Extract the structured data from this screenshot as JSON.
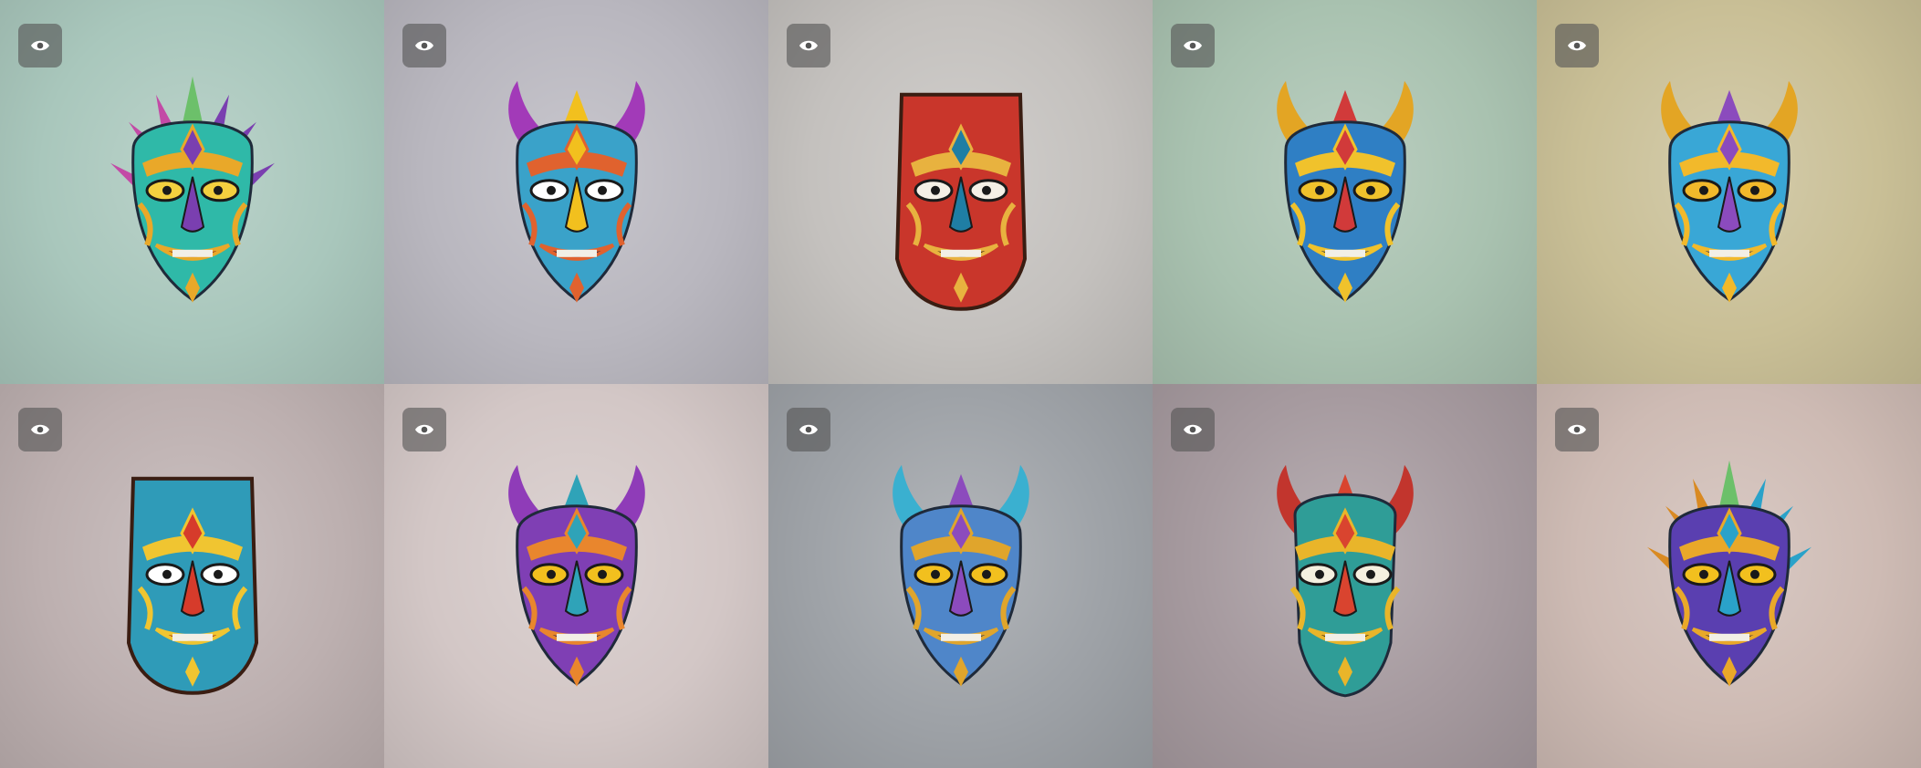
{
  "gallery": {
    "tiles": [
      {
        "bg": "#a9c7bc",
        "mask": "spiky",
        "palette": {
          "base": "#2fb9a8",
          "accent": "#e9a829",
          "horn": "#c34aa6",
          "eye": "#f4d03f",
          "mouth": "#8a2e1e",
          "detail": "#7a3fb0"
        },
        "view_icon": "eye-icon"
      },
      {
        "bg": "#b9b7bf",
        "mask": "horned-round",
        "palette": {
          "base": "#3aa2c9",
          "accent": "#e0622e",
          "horn": "#a23ab8",
          "eye": "#ffffff",
          "mouth": "#1d2a4a",
          "detail": "#f2c01e"
        },
        "view_icon": "eye-icon"
      },
      {
        "bg": "#c4c1be",
        "mask": "tiki",
        "palette": {
          "base": "#c9362b",
          "accent": "#e8b23f",
          "horn": "#2f93a8",
          "eye": "#f5f0e6",
          "mouth": "#2b1410",
          "detail": "#1f7ea4"
        },
        "view_icon": "eye-icon"
      },
      {
        "bg": "#a9c2b0",
        "mask": "horned-oval",
        "palette": {
          "base": "#2f7fc4",
          "accent": "#f0c22c",
          "horn": "#e3a524",
          "eye": "#f0c22c",
          "mouth": "#1a2a5a",
          "detail": "#d13a3a"
        },
        "view_icon": "eye-icon"
      },
      {
        "bg": "#c9bf96",
        "mask": "horned-oval",
        "palette": {
          "base": "#39a7d6",
          "accent": "#f2b92b",
          "horn": "#e3a524",
          "eye": "#f2b92b",
          "mouth": "#2a3066",
          "detail": "#8b4bbd"
        },
        "view_icon": "eye-icon"
      },
      {
        "bg": "#bdb0b0",
        "mask": "tiki",
        "palette": {
          "base": "#2f9bb8",
          "accent": "#f0c531",
          "horn": "#d63b2b",
          "eye": "#ffffff",
          "mouth": "#9a1f1f",
          "detail": "#d63b2b"
        },
        "view_icon": "eye-icon"
      },
      {
        "bg": "#d3c7c6",
        "mask": "horned-oval",
        "palette": {
          "base": "#7f3fb4",
          "accent": "#e9862d",
          "horn": "#8f3cb8",
          "eye": "#f2c01e",
          "mouth": "#2b1f4a",
          "detail": "#2fa3b8"
        },
        "view_icon": "eye-icon"
      },
      {
        "bg": "#9ea2a7",
        "mask": "horned-oval",
        "palette": {
          "base": "#4f86c9",
          "accent": "#e0a52c",
          "horn": "#3ab0d0",
          "eye": "#f2c01e",
          "mouth": "#1e2c5c",
          "detail": "#8c4bbd"
        },
        "view_icon": "eye-icon"
      },
      {
        "bg": "#a69a9f",
        "mask": "horned-long",
        "palette": {
          "base": "#2f9d97",
          "accent": "#e9b52a",
          "horn": "#c2352d",
          "eye": "#f5f0e0",
          "mouth": "#2b1410",
          "detail": "#d9442f"
        },
        "view_icon": "eye-icon"
      },
      {
        "bg": "#cebbb4",
        "mask": "spiky",
        "palette": {
          "base": "#5a3fb0",
          "accent": "#e9a829",
          "horn": "#d98a22",
          "eye": "#f2c01e",
          "mouth": "#2b1f4a",
          "detail": "#2aa2c9"
        },
        "view_icon": "eye-icon"
      }
    ]
  }
}
